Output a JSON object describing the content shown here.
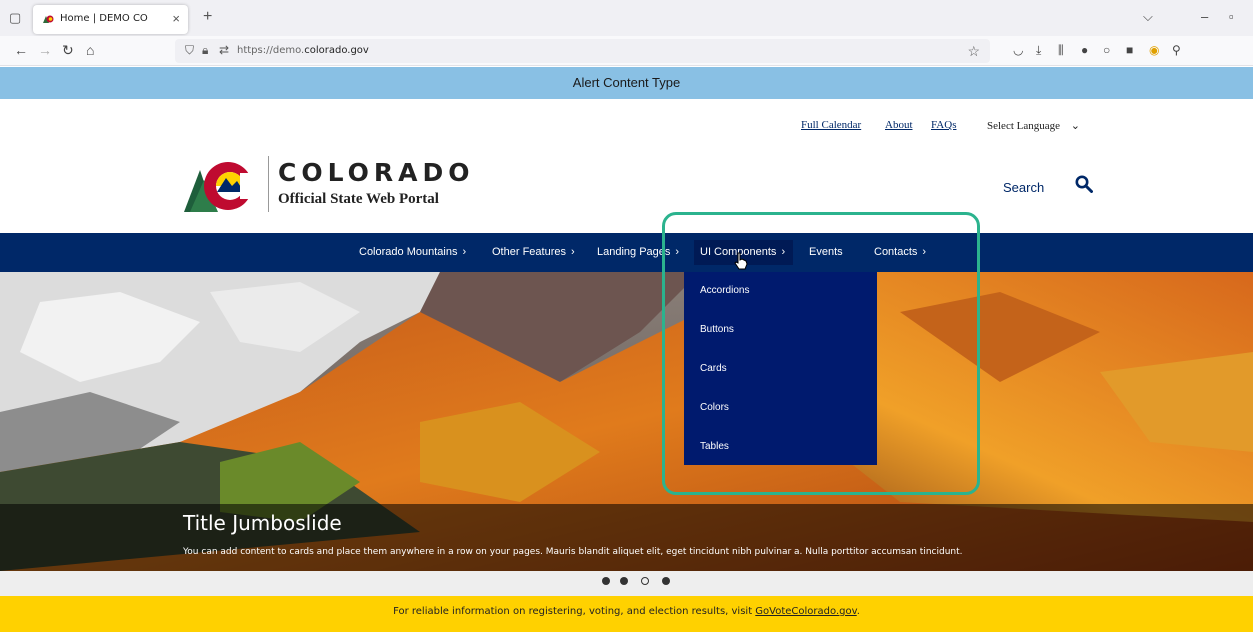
{
  "browser": {
    "tab_title": "Home | DEMO CO",
    "url_prefix": "https://demo.",
    "url_domain": "colorado.gov"
  },
  "alert": {
    "text": "Alert Content Type"
  },
  "utility_links": [
    {
      "label": "Full Calendar"
    },
    {
      "label": "About"
    },
    {
      "label": "FAQs"
    }
  ],
  "language": {
    "label": "Select Language"
  },
  "logo": {
    "wordmark": "COLORADO",
    "subtitle": "Official State Web Portal"
  },
  "search": {
    "label": "Search"
  },
  "nav": [
    {
      "label": "Colorado Mountains",
      "chevron": "›"
    },
    {
      "label": "Other Features",
      "chevron": "›"
    },
    {
      "label": "Landing Pages",
      "chevron": "›"
    },
    {
      "label": "UI Components",
      "chevron": "›"
    },
    {
      "label": "Events",
      "chevron": ""
    },
    {
      "label": "Contacts",
      "chevron": "›"
    }
  ],
  "dropdown": [
    {
      "label": "Accordions"
    },
    {
      "label": "Buttons"
    },
    {
      "label": "Cards"
    },
    {
      "label": "Colors"
    },
    {
      "label": "Tables"
    }
  ],
  "slide": {
    "title": "Title Jumboslide",
    "text": "You can add content to cards and place them anywhere in a row on your pages. Mauris blandit aliquet elit, eget tincidunt nibh pulvinar a. Nulla porttitor accumsan tincidunt."
  },
  "carousel": {
    "total": 4,
    "current": 3
  },
  "election": {
    "text": "For reliable information on registering, voting, and election results, visit ",
    "link": "GoVoteColorado.gov",
    "suffix": "."
  },
  "colors": {
    "brand_blue": "#002868",
    "alert_blue": "#89c0e4",
    "election_yellow": "#ffd100",
    "highlight_green": "#2bb38e"
  }
}
